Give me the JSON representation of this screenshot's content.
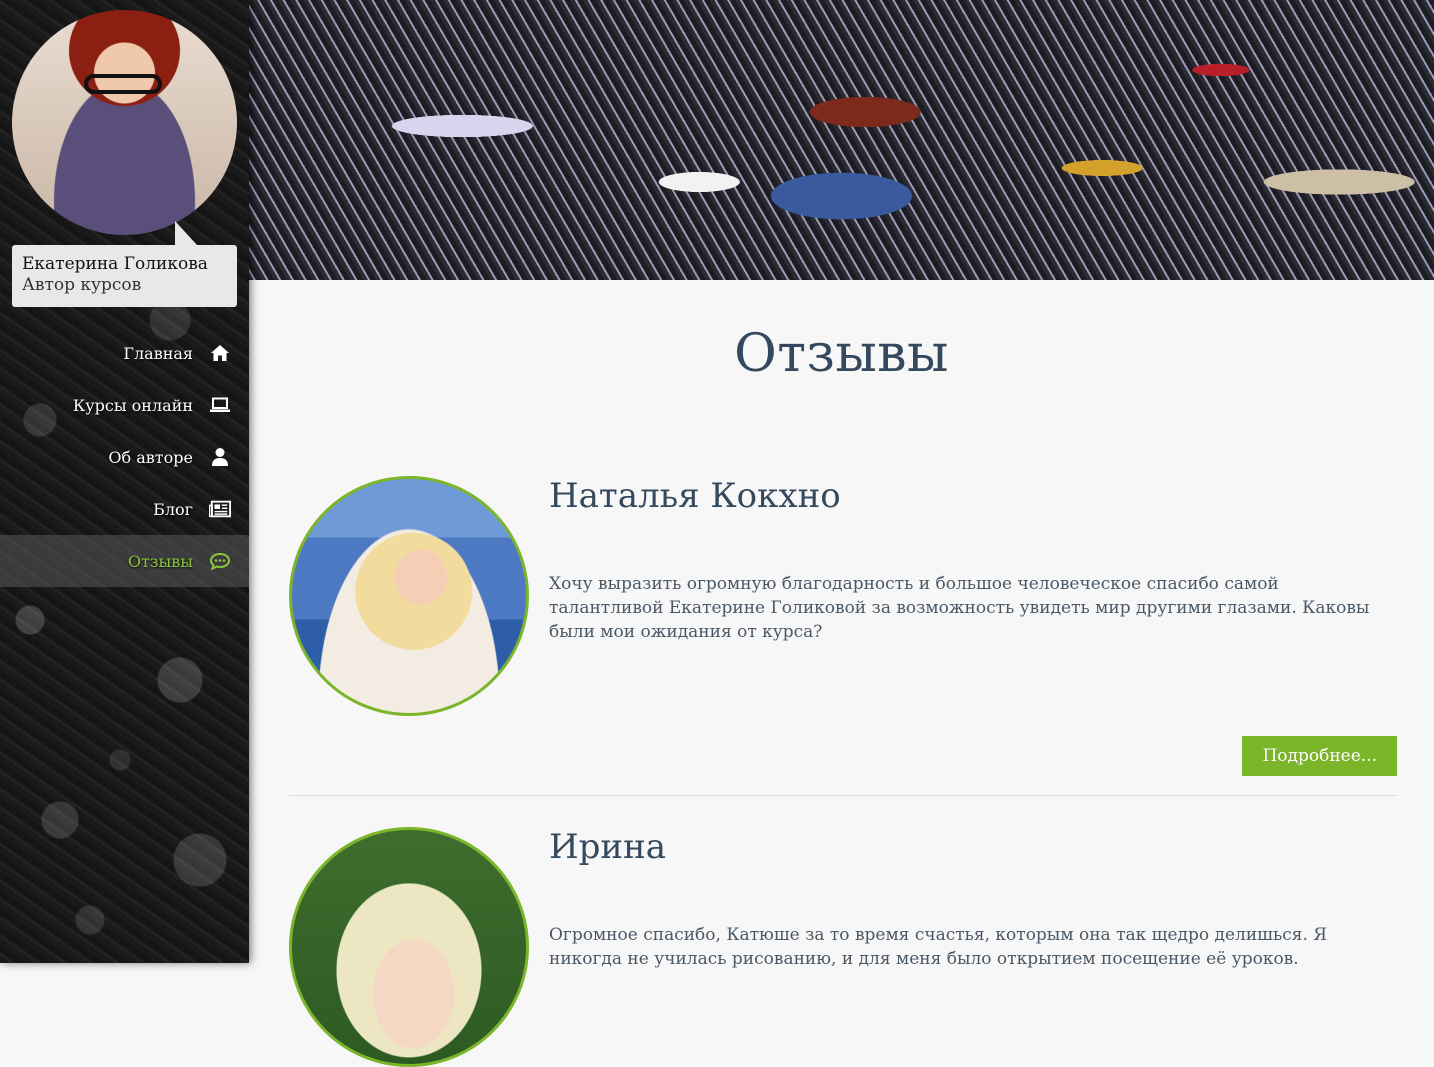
{
  "sidebar": {
    "author": {
      "name": "Екатерина Голикова",
      "role": "Автор курсов"
    },
    "nav": [
      {
        "label": "Главная",
        "icon": "home-icon",
        "active": false
      },
      {
        "label": "Курсы онлайн",
        "icon": "laptop-icon",
        "active": false
      },
      {
        "label": "Об авторе",
        "icon": "user-icon",
        "active": false
      },
      {
        "label": "Блог",
        "icon": "newspaper-icon",
        "active": false
      },
      {
        "label": "Отзывы",
        "icon": "comments-icon",
        "active": true
      }
    ]
  },
  "main": {
    "title": "Отзывы",
    "reviews": [
      {
        "name": "Наталья Кокхно",
        "text": "Хочу выразить огромную благодарность и большое человеческое спасибо самой талантливой Екатерине Голиковой за возможность увидеть мир другими глазами. Каковы были мои ожидания от курса?",
        "button": "Подробнее..."
      },
      {
        "name": "Ирина",
        "text": "Огромное спасибо, Катюше за то время счастья, которым она так щедро делишься. Я никогда не училась рисованию, и для меня было открытием посещение её уроков."
      }
    ]
  },
  "colors": {
    "accent": "#7ab52a",
    "active_nav": "#8cc63f",
    "heading": "#34495e",
    "body_text": "#4a5866"
  }
}
